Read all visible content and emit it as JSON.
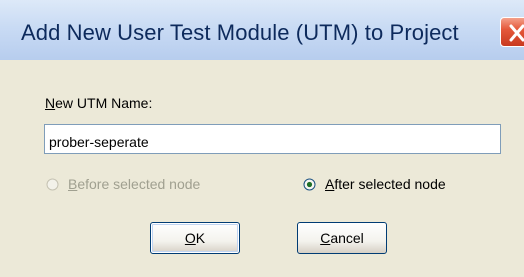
{
  "window": {
    "title": "Add New User Test Module (UTM) to Project"
  },
  "form": {
    "name_label_accel": "N",
    "name_label_rest": "ew UTM Name:",
    "name_value": "prober-seperate"
  },
  "options": {
    "before_accel": "B",
    "before_rest": "efore selected node",
    "before_enabled": false,
    "before_selected": false,
    "after_accel": "A",
    "after_rest": "fter selected node",
    "after_selected": true
  },
  "buttons": {
    "ok_accel": "O",
    "ok_rest": "K",
    "cancel_accel": "C",
    "cancel_rest": "ancel"
  },
  "colors": {
    "title_text": "#0d2a5c",
    "dialog_bg": "#ece9d8",
    "disabled_text": "#a0a090",
    "close_button": "#e5593b"
  },
  "icons": {
    "close": "close-icon"
  }
}
